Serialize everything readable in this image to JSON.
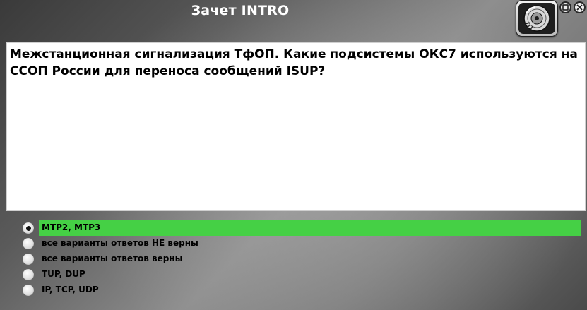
{
  "window": {
    "title": "Зачет INTRO"
  },
  "icons": {
    "logo": "disc-logo-icon",
    "maximize": "maximize-icon",
    "close": "close-icon"
  },
  "colors": {
    "selected_highlight": "#45d045",
    "question_background": "#ffffff"
  },
  "question": {
    "text": "Межстанционная сигнализация ТфОП. Какие подсистемы ОКС7 используются на ССОП России для переноса сообщений ISUP?"
  },
  "answers": [
    {
      "label": "МТР2, МТР3",
      "selected": true
    },
    {
      "label": "все варианты ответов НЕ верны",
      "selected": false
    },
    {
      "label": "все варианты ответов верны",
      "selected": false
    },
    {
      "label": "TUP, DUP",
      "selected": false
    },
    {
      "label": "IP, TCP, UDP",
      "selected": false
    }
  ]
}
